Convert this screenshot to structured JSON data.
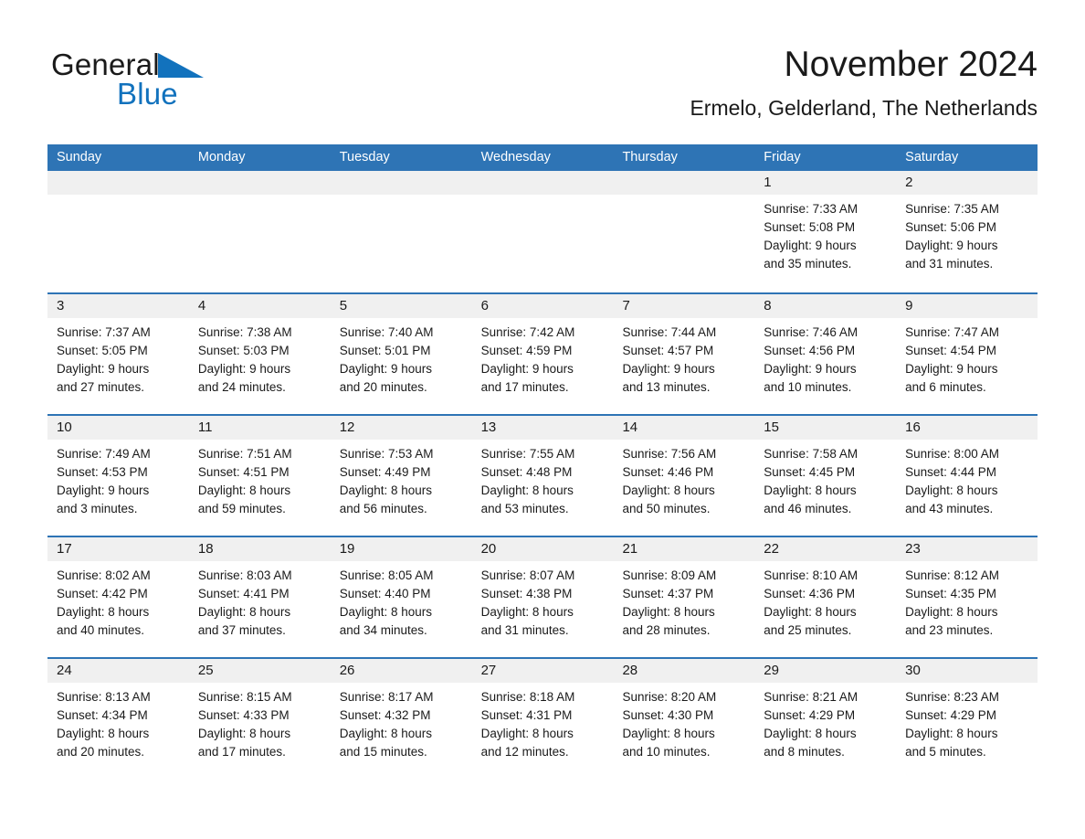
{
  "brand": {
    "name_part1": "General",
    "name_part2": "Blue",
    "triangle_icon": "blue-triangle-icon",
    "colors": {
      "black": "#1a1a1a",
      "blue": "#1272bd"
    }
  },
  "header": {
    "month_title": "November 2024",
    "location": "Ermelo, Gelderland, The Netherlands"
  },
  "calendar": {
    "accent_color": "#2e74b5",
    "day_strip_color": "#f0f0f0",
    "weekday_headers": [
      "Sunday",
      "Monday",
      "Tuesday",
      "Wednesday",
      "Thursday",
      "Friday",
      "Saturday"
    ],
    "weeks": [
      [
        {
          "day": "",
          "lines": []
        },
        {
          "day": "",
          "lines": []
        },
        {
          "day": "",
          "lines": []
        },
        {
          "day": "",
          "lines": []
        },
        {
          "day": "",
          "lines": []
        },
        {
          "day": "1",
          "lines": [
            "Sunrise: 7:33 AM",
            "Sunset: 5:08 PM",
            "Daylight: 9 hours",
            "and 35 minutes."
          ]
        },
        {
          "day": "2",
          "lines": [
            "Sunrise: 7:35 AM",
            "Sunset: 5:06 PM",
            "Daylight: 9 hours",
            "and 31 minutes."
          ]
        }
      ],
      [
        {
          "day": "3",
          "lines": [
            "Sunrise: 7:37 AM",
            "Sunset: 5:05 PM",
            "Daylight: 9 hours",
            "and 27 minutes."
          ]
        },
        {
          "day": "4",
          "lines": [
            "Sunrise: 7:38 AM",
            "Sunset: 5:03 PM",
            "Daylight: 9 hours",
            "and 24 minutes."
          ]
        },
        {
          "day": "5",
          "lines": [
            "Sunrise: 7:40 AM",
            "Sunset: 5:01 PM",
            "Daylight: 9 hours",
            "and 20 minutes."
          ]
        },
        {
          "day": "6",
          "lines": [
            "Sunrise: 7:42 AM",
            "Sunset: 4:59 PM",
            "Daylight: 9 hours",
            "and 17 minutes."
          ]
        },
        {
          "day": "7",
          "lines": [
            "Sunrise: 7:44 AM",
            "Sunset: 4:57 PM",
            "Daylight: 9 hours",
            "and 13 minutes."
          ]
        },
        {
          "day": "8",
          "lines": [
            "Sunrise: 7:46 AM",
            "Sunset: 4:56 PM",
            "Daylight: 9 hours",
            "and 10 minutes."
          ]
        },
        {
          "day": "9",
          "lines": [
            "Sunrise: 7:47 AM",
            "Sunset: 4:54 PM",
            "Daylight: 9 hours",
            "and 6 minutes."
          ]
        }
      ],
      [
        {
          "day": "10",
          "lines": [
            "Sunrise: 7:49 AM",
            "Sunset: 4:53 PM",
            "Daylight: 9 hours",
            "and 3 minutes."
          ]
        },
        {
          "day": "11",
          "lines": [
            "Sunrise: 7:51 AM",
            "Sunset: 4:51 PM",
            "Daylight: 8 hours",
            "and 59 minutes."
          ]
        },
        {
          "day": "12",
          "lines": [
            "Sunrise: 7:53 AM",
            "Sunset: 4:49 PM",
            "Daylight: 8 hours",
            "and 56 minutes."
          ]
        },
        {
          "day": "13",
          "lines": [
            "Sunrise: 7:55 AM",
            "Sunset: 4:48 PM",
            "Daylight: 8 hours",
            "and 53 minutes."
          ]
        },
        {
          "day": "14",
          "lines": [
            "Sunrise: 7:56 AM",
            "Sunset: 4:46 PM",
            "Daylight: 8 hours",
            "and 50 minutes."
          ]
        },
        {
          "day": "15",
          "lines": [
            "Sunrise: 7:58 AM",
            "Sunset: 4:45 PM",
            "Daylight: 8 hours",
            "and 46 minutes."
          ]
        },
        {
          "day": "16",
          "lines": [
            "Sunrise: 8:00 AM",
            "Sunset: 4:44 PM",
            "Daylight: 8 hours",
            "and 43 minutes."
          ]
        }
      ],
      [
        {
          "day": "17",
          "lines": [
            "Sunrise: 8:02 AM",
            "Sunset: 4:42 PM",
            "Daylight: 8 hours",
            "and 40 minutes."
          ]
        },
        {
          "day": "18",
          "lines": [
            "Sunrise: 8:03 AM",
            "Sunset: 4:41 PM",
            "Daylight: 8 hours",
            "and 37 minutes."
          ]
        },
        {
          "day": "19",
          "lines": [
            "Sunrise: 8:05 AM",
            "Sunset: 4:40 PM",
            "Daylight: 8 hours",
            "and 34 minutes."
          ]
        },
        {
          "day": "20",
          "lines": [
            "Sunrise: 8:07 AM",
            "Sunset: 4:38 PM",
            "Daylight: 8 hours",
            "and 31 minutes."
          ]
        },
        {
          "day": "21",
          "lines": [
            "Sunrise: 8:09 AM",
            "Sunset: 4:37 PM",
            "Daylight: 8 hours",
            "and 28 minutes."
          ]
        },
        {
          "day": "22",
          "lines": [
            "Sunrise: 8:10 AM",
            "Sunset: 4:36 PM",
            "Daylight: 8 hours",
            "and 25 minutes."
          ]
        },
        {
          "day": "23",
          "lines": [
            "Sunrise: 8:12 AM",
            "Sunset: 4:35 PM",
            "Daylight: 8 hours",
            "and 23 minutes."
          ]
        }
      ],
      [
        {
          "day": "24",
          "lines": [
            "Sunrise: 8:13 AM",
            "Sunset: 4:34 PM",
            "Daylight: 8 hours",
            "and 20 minutes."
          ]
        },
        {
          "day": "25",
          "lines": [
            "Sunrise: 8:15 AM",
            "Sunset: 4:33 PM",
            "Daylight: 8 hours",
            "and 17 minutes."
          ]
        },
        {
          "day": "26",
          "lines": [
            "Sunrise: 8:17 AM",
            "Sunset: 4:32 PM",
            "Daylight: 8 hours",
            "and 15 minutes."
          ]
        },
        {
          "day": "27",
          "lines": [
            "Sunrise: 8:18 AM",
            "Sunset: 4:31 PM",
            "Daylight: 8 hours",
            "and 12 minutes."
          ]
        },
        {
          "day": "28",
          "lines": [
            "Sunrise: 8:20 AM",
            "Sunset: 4:30 PM",
            "Daylight: 8 hours",
            "and 10 minutes."
          ]
        },
        {
          "day": "29",
          "lines": [
            "Sunrise: 8:21 AM",
            "Sunset: 4:29 PM",
            "Daylight: 8 hours",
            "and 8 minutes."
          ]
        },
        {
          "day": "30",
          "lines": [
            "Sunrise: 8:23 AM",
            "Sunset: 4:29 PM",
            "Daylight: 8 hours",
            "and 5 minutes."
          ]
        }
      ]
    ]
  }
}
